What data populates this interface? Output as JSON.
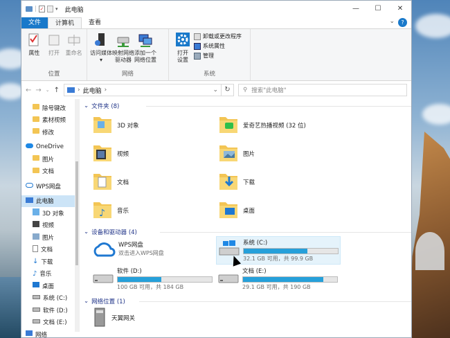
{
  "window": {
    "title": "此电脑",
    "min": "—",
    "max": "☐",
    "close": "✕"
  },
  "tabs": {
    "file": "文件",
    "computer": "计算机",
    "view": "查看"
  },
  "ribbon": {
    "location": {
      "label": "位置",
      "properties": "属性",
      "open": "打开",
      "rename": "重命名"
    },
    "network": {
      "label": "网络",
      "media_line1": "访问媒体",
      "map_line1": "映射网络",
      "map_line2": "驱动器",
      "addloc_line1": "添加一个",
      "addloc_line2": "网络位置"
    },
    "system": {
      "label": "系统",
      "opensettings_line1": "打开",
      "opensettings_line2": "设置",
      "uninstall": "卸载或更改程序",
      "sysprops": "系统属性",
      "manage": "管理"
    }
  },
  "address": {
    "crumb": "此电脑",
    "search_placeholder": "搜索\"此电脑\""
  },
  "sidebar": {
    "items": [
      {
        "label": "除号键改",
        "icon": "folder-icon"
      },
      {
        "label": "素材视频",
        "icon": "folder-icon"
      },
      {
        "label": "修改",
        "icon": "folder-icon"
      },
      {
        "label": "OneDrive",
        "icon": "cloud-icon"
      },
      {
        "label": "图片",
        "icon": "folder-icon"
      },
      {
        "label": "文档",
        "icon": "folder-icon"
      },
      {
        "label": "WPS网盘",
        "icon": "wps-cloud-icon"
      },
      {
        "label": "此电脑",
        "icon": "pc-icon"
      },
      {
        "label": "3D 对象",
        "icon": "3d-icon"
      },
      {
        "label": "视频",
        "icon": "video-icon"
      },
      {
        "label": "图片",
        "icon": "picture-icon"
      },
      {
        "label": "文档",
        "icon": "document-icon"
      },
      {
        "label": "下载",
        "icon": "download-icon"
      },
      {
        "label": "音乐",
        "icon": "music-icon"
      },
      {
        "label": "桌面",
        "icon": "desktop-icon"
      },
      {
        "label": "系统 (C:)",
        "icon": "drive-icon"
      },
      {
        "label": "软件 (D:)",
        "icon": "drive-icon"
      },
      {
        "label": "文档 (E:)",
        "icon": "drive-icon"
      },
      {
        "label": "网络",
        "icon": "network-icon"
      }
    ]
  },
  "sections": {
    "folders": "文件夹 (8)",
    "devices": "设备和驱动器 (4)",
    "network": "网络位置 (1)"
  },
  "folders": [
    {
      "label": "3D 对象"
    },
    {
      "label": "爱奇艺热播视频 (32 位)"
    },
    {
      "label": "视频"
    },
    {
      "label": "图片"
    },
    {
      "label": "文档"
    },
    {
      "label": "下载"
    },
    {
      "label": "音乐"
    },
    {
      "label": "桌面"
    }
  ],
  "devices": {
    "wps": {
      "label": "WPS网盘",
      "sub": "双击进入WPS网盘"
    },
    "c": {
      "label": "系统 (C:)",
      "sub": "32.1 GB 可用，共 99.9 GB",
      "fill": 0.68
    },
    "d": {
      "label": "软件 (D:)",
      "sub": "100 GB 可用，共 184 GB",
      "fill": 0.46
    },
    "e": {
      "label": "文档 (E:)",
      "sub": "29.1 GB 可用，共 190 GB",
      "fill": 0.85
    }
  },
  "network_locations": [
    {
      "label": "天翼网关"
    }
  ],
  "colors": {
    "accent": "#1979ca",
    "bar": "#26a0da",
    "folder": "#f3c554"
  }
}
